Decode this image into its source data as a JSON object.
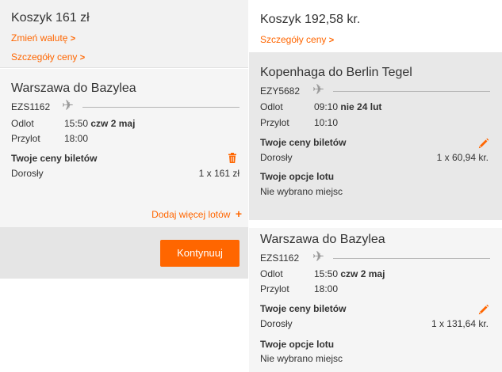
{
  "left": {
    "cart_title": "Koszyk 161 zł",
    "change_currency": "Zmień walutę",
    "price_details": "Szczegóły ceny",
    "flight": {
      "route": "Warszawa do Bazylea",
      "code": "EZS1162",
      "departure_label": "Odlot",
      "departure_time": "15:50",
      "departure_date": "czw 2 maj",
      "arrival_label": "Przylot",
      "arrival_time": "18:00",
      "fares_title": "Twoje ceny biletów",
      "passenger_type": "Dorosły",
      "fare": "1 x 161 zł"
    },
    "add_flights": "Dodaj więcej lotów",
    "continue_button": "Kontynuuj"
  },
  "right": {
    "cart_title": "Koszyk 192,58 kr.",
    "price_details": "Szczegóły ceny",
    "flights": [
      {
        "route": "Kopenhaga do Berlin Tegel",
        "code": "EZY5682",
        "departure_label": "Odlot",
        "departure_time": "09:10",
        "departure_date": "nie 24 lut",
        "arrival_label": "Przylot",
        "arrival_time": "10:10",
        "fares_title": "Twoje ceny biletów",
        "passenger_type": "Dorosły",
        "fare": "1 x 60,94 kr.",
        "options_title": "Twoje opcje lotu",
        "options_value": "Nie wybrano miejsc"
      },
      {
        "route": "Warszawa do Bazylea",
        "code": "EZS1162",
        "departure_label": "Odlot",
        "departure_time": "15:50",
        "departure_date": "czw 2 maj",
        "arrival_label": "Przylot",
        "arrival_time": "18:00",
        "fares_title": "Twoje ceny biletów",
        "passenger_type": "Dorosły",
        "fare": "1 x 131,64 kr.",
        "options_title": "Twoje opcje lotu",
        "options_value": "Nie wybrano miejsc"
      }
    ]
  },
  "icons": {
    "plane": "airplane-icon",
    "trash": "trash-icon",
    "edit": "pencil-icon",
    "plus": "plus-icon",
    "chevron": "chevron-right-icon"
  },
  "colors": {
    "accent": "#ff6600",
    "text": "#333333",
    "panel_light": "#f5f5f5",
    "panel_selected": "#e8e8e8"
  }
}
